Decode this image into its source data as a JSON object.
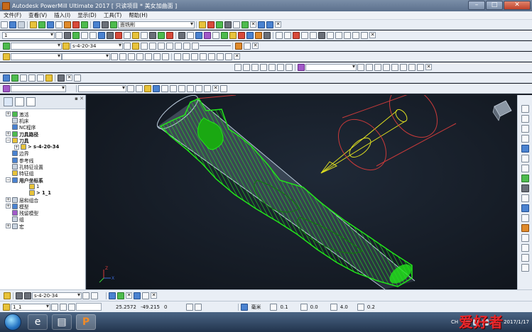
{
  "window": {
    "title": "Autodesk PowerMill Ultimate 2017   [ 只读项目 * 美女加曲面 ]",
    "controls": [
      "–",
      "□",
      "✕"
    ]
  },
  "menu": [
    "文件(F)",
    "查看(V)",
    "插入(I)",
    "显示(D)",
    "工具(T)",
    "帮助(H)"
  ],
  "toolbars": {
    "row1_combo": "面铣削",
    "row2_combo": "1",
    "row3_toolpath_combo": "s-4-20-34",
    "row4_combo": "",
    "row5_combo": "",
    "row6_combo": "",
    "row6_combo2": ""
  },
  "explorer": {
    "nodes": [
      {
        "label": "激活",
        "indent": 0,
        "exp": "+",
        "bold": false,
        "icon_color": "#4dbb4d"
      },
      {
        "label": "机床",
        "indent": 0,
        "exp": "",
        "bold": false,
        "icon_color": "#c9d3df"
      },
      {
        "label": "NC程序",
        "indent": 0,
        "exp": "",
        "bold": false,
        "icon_color": "#4a82d0"
      },
      {
        "label": "刀具路径",
        "indent": 0,
        "exp": "+",
        "bold": true,
        "icon_color": "#4dbb4d"
      },
      {
        "label": "刀具",
        "indent": 0,
        "exp": "−",
        "bold": true,
        "icon_color": "#e8c33a"
      },
      {
        "label": "> s-4-20-34",
        "indent": 1,
        "exp": "+",
        "bold": true,
        "icon_color": "#e8c33a"
      },
      {
        "label": "边界",
        "indent": 0,
        "exp": "",
        "bold": false,
        "icon_color": "#4a82d0"
      },
      {
        "label": "参考线",
        "indent": 0,
        "exp": "",
        "bold": false,
        "icon_color": "#4a82d0"
      },
      {
        "label": "孔特征设置",
        "indent": 0,
        "exp": "",
        "bold": false,
        "icon_color": "#c9d3df"
      },
      {
        "label": "特征组",
        "indent": 0,
        "exp": "",
        "bold": false,
        "icon_color": "#e8c33a"
      },
      {
        "label": "用户坐标系",
        "indent": 0,
        "exp": "−",
        "bold": true,
        "icon_color": "#4a82d0"
      },
      {
        "label": "1",
        "indent": 2,
        "exp": "",
        "bold": false,
        "icon_color": "#e8c33a"
      },
      {
        "label": "> 1_1",
        "indent": 2,
        "exp": "",
        "bold": true,
        "icon_color": "#e8c33a"
      },
      {
        "label": "层和组合",
        "indent": 0,
        "exp": "+",
        "bold": false,
        "icon_color": "#c9d3df"
      },
      {
        "label": "模型",
        "indent": 0,
        "exp": "+",
        "bold": false,
        "icon_color": "#4a82d0"
      },
      {
        "label": "残留模型",
        "indent": 0,
        "exp": "",
        "bold": false,
        "icon_color": "#a25ac8"
      },
      {
        "label": "组",
        "indent": 0,
        "exp": "",
        "bold": false,
        "icon_color": "#c9d3df"
      },
      {
        "label": "宏",
        "indent": 0,
        "exp": "+",
        "bold": false,
        "icon_color": "#c9d3df"
      }
    ]
  },
  "tool_row": {
    "toolpath": "s-4-20-34"
  },
  "status": {
    "workplane": "1_1",
    "x": "25.2572",
    "y": "-49.215",
    "z": "0",
    "units": "毫米",
    "tolerance": "0.1",
    "thickness": "0.0",
    "diameter": "4.0",
    "stepover": "0.2"
  },
  "taskbar": {
    "language": "CH",
    "date": "2017/1/17",
    "watermark": "爱好者"
  },
  "colors": {
    "toolpath_green": "#22e61a",
    "viewport_bg": "#161c25",
    "stock_outline": "#b8c8d8",
    "tool_holder": "#c83a3a",
    "tool_cutter": "#e0e020"
  }
}
